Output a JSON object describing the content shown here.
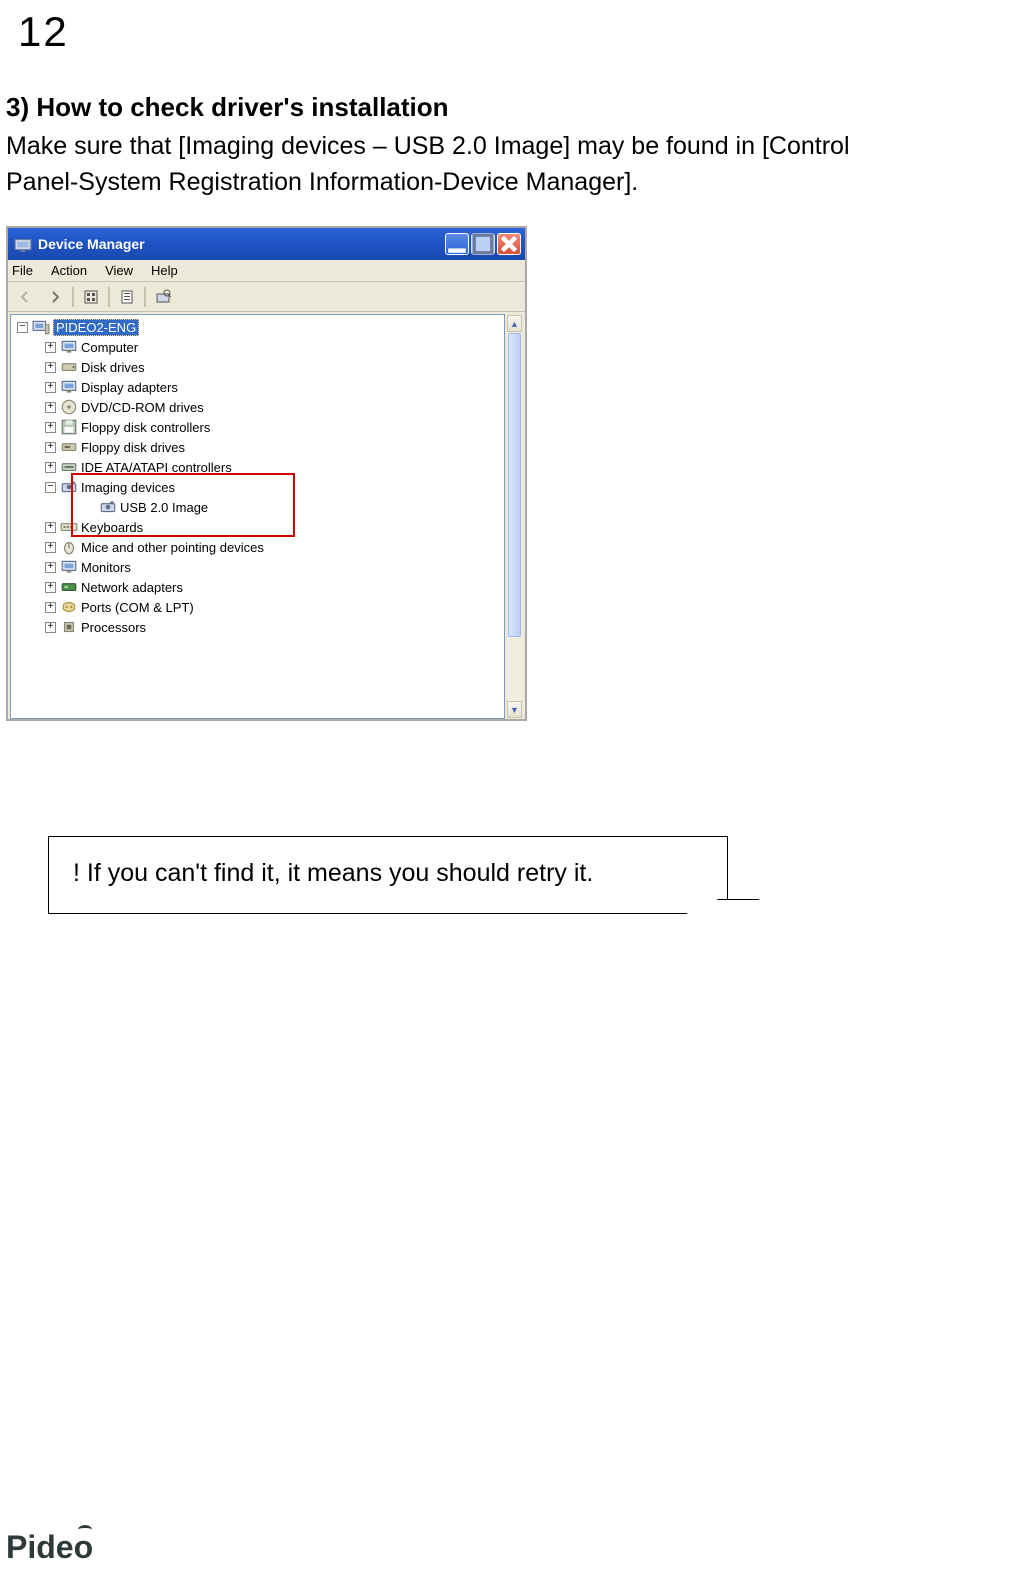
{
  "page_number": "12",
  "heading": "3) How to check driver's installation",
  "body_line1": "Make sure that [Imaging devices – USB 2.0 Image] may be found in [Control",
  "body_line2": "Panel-System Registration Information-Device Manager].",
  "window": {
    "title": "Device Manager",
    "minimize_label": "Minimize",
    "maximize_label": "Maximize",
    "close_label": "Close"
  },
  "menus": {
    "file": "File",
    "action": "Action",
    "view": "View",
    "help": "Help"
  },
  "tree": {
    "root": "PIDEO2-ENG",
    "items": [
      {
        "label": "Computer"
      },
      {
        "label": "Disk drives"
      },
      {
        "label": "Display adapters"
      },
      {
        "label": "DVD/CD-ROM drives"
      },
      {
        "label": "Floppy disk controllers"
      },
      {
        "label": "Floppy disk drives"
      },
      {
        "label": "IDE ATA/ATAPI controllers"
      },
      {
        "label": "Imaging devices",
        "expanded": true,
        "children": [
          {
            "label": "USB 2.0 Image"
          }
        ]
      },
      {
        "label": "Keyboards"
      },
      {
        "label": "Mice and other pointing devices"
      },
      {
        "label": "Monitors"
      },
      {
        "label": "Network adapters"
      },
      {
        "label": "Ports (COM & LPT)"
      },
      {
        "label": "Processors"
      }
    ]
  },
  "note": "! If you can't find it, it means you should retry it.",
  "brand": "Pideo"
}
